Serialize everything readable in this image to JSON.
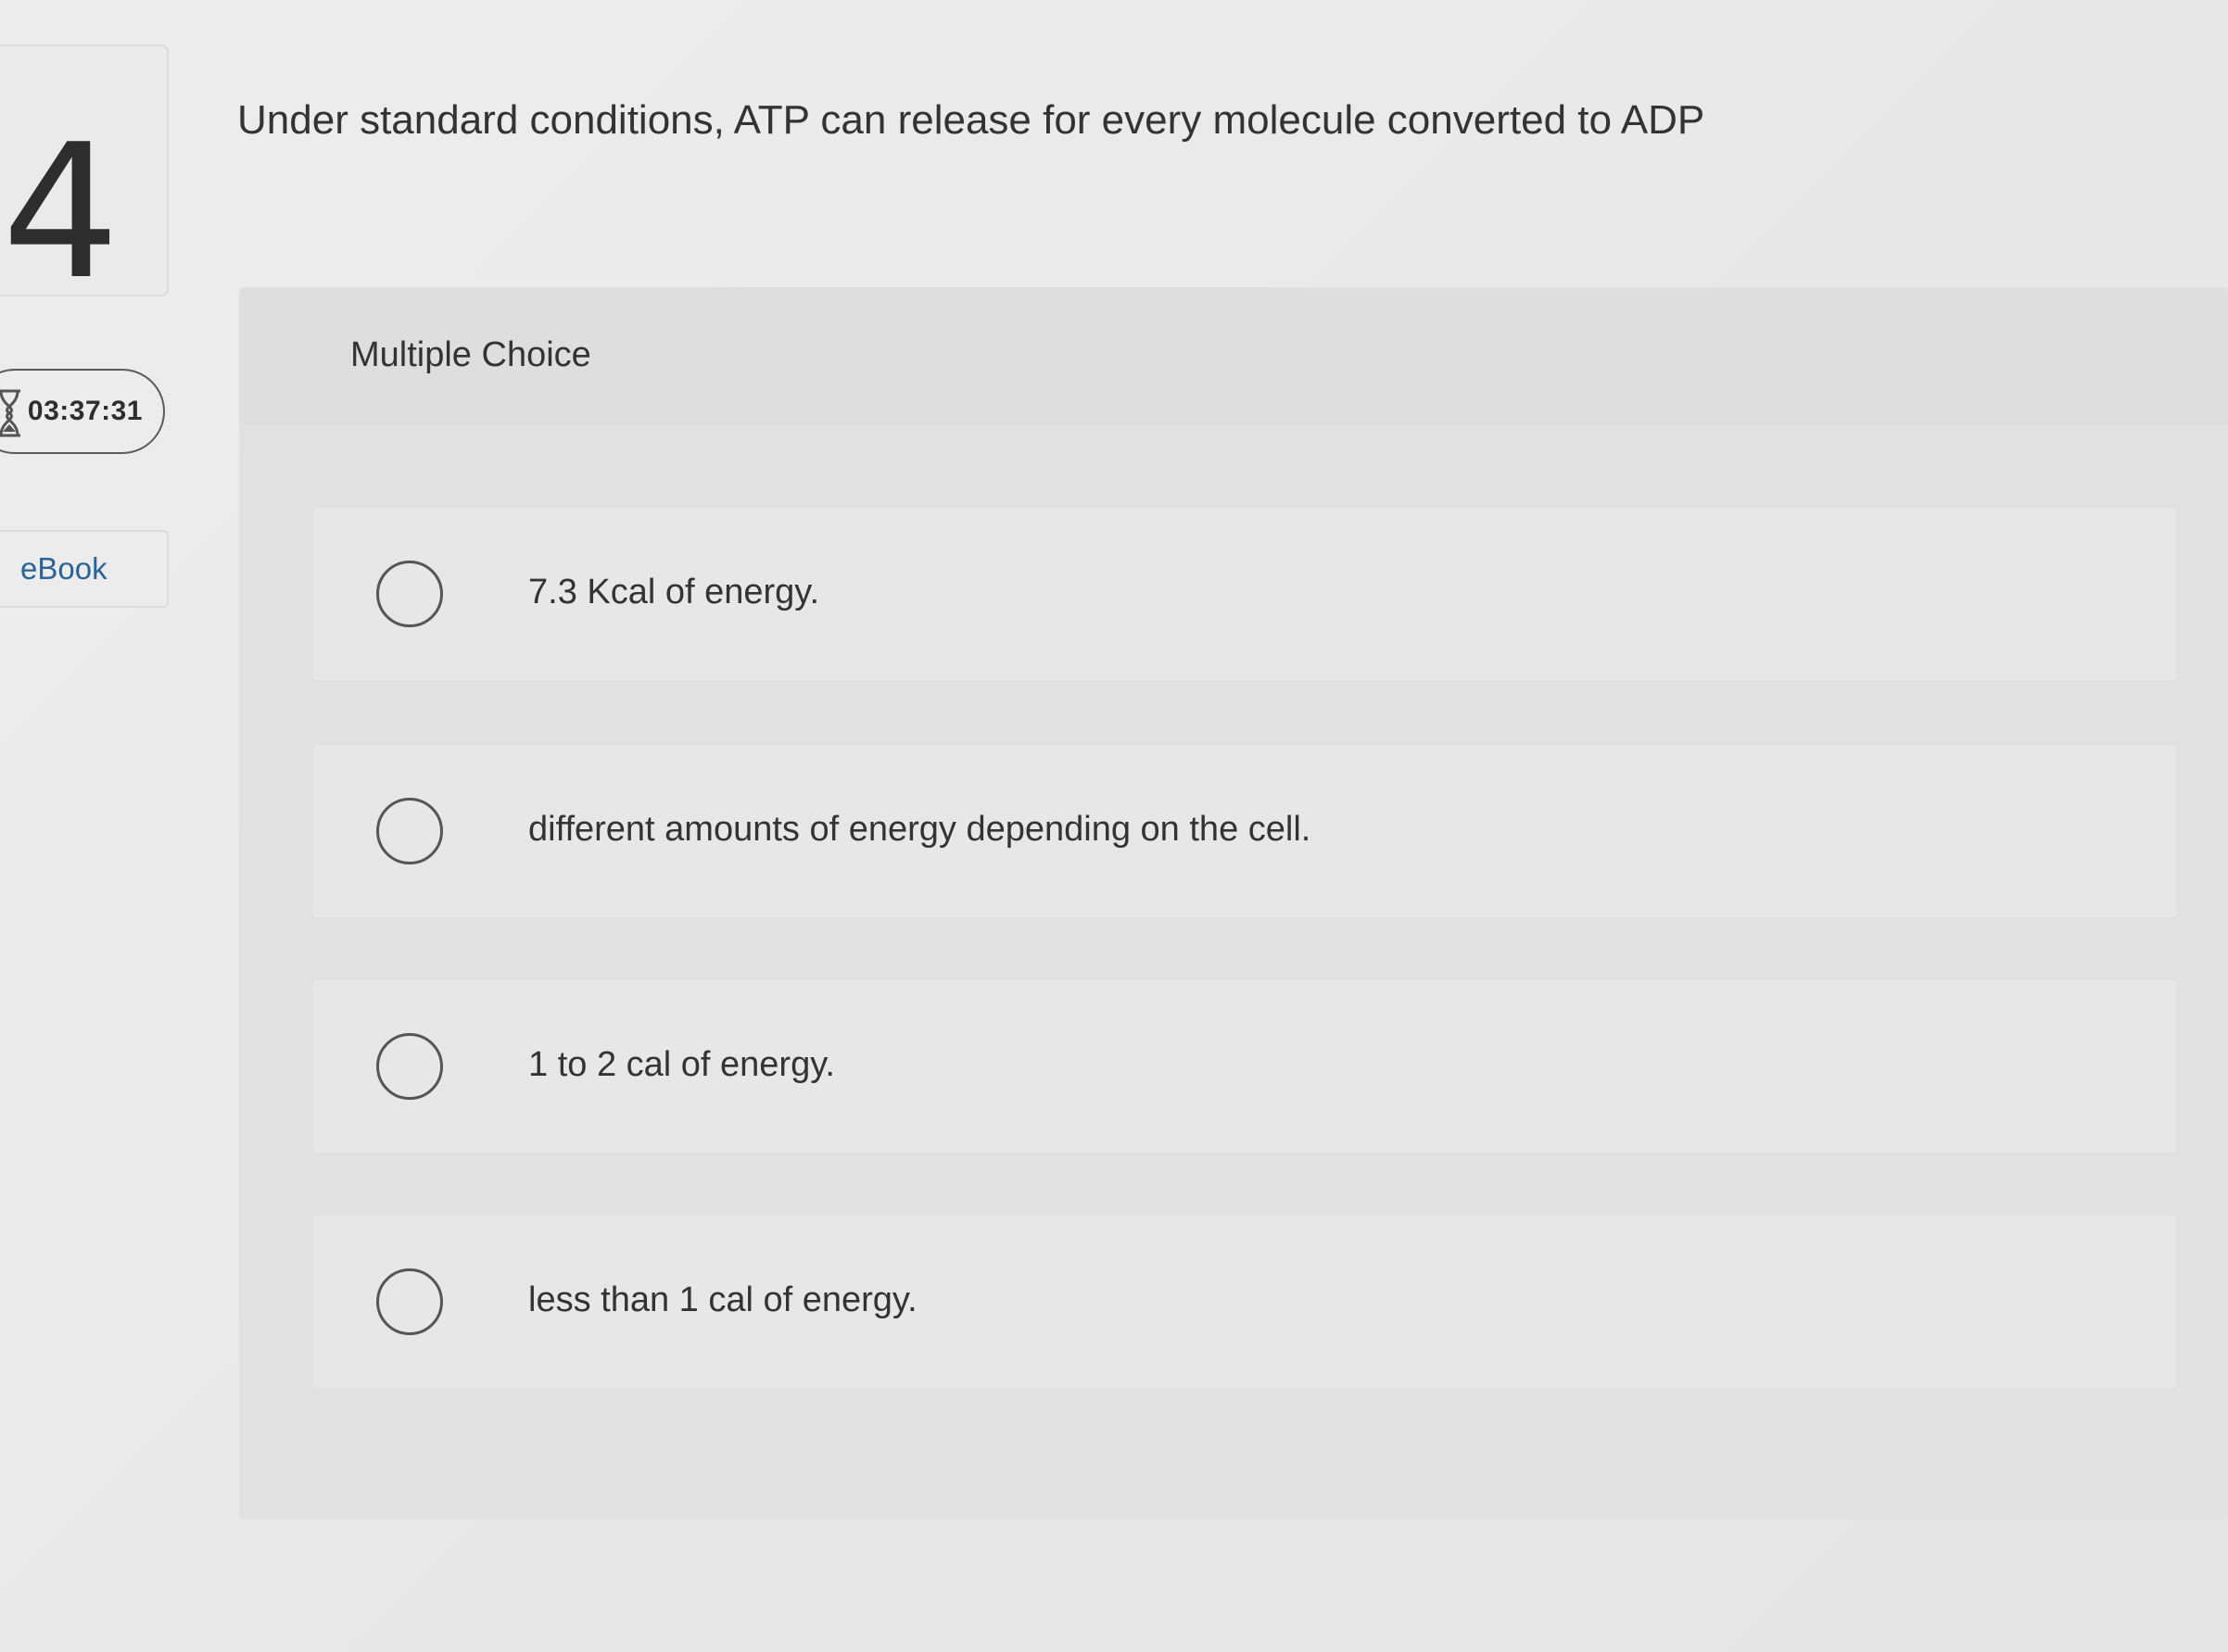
{
  "sidebar": {
    "question_number": "4",
    "timer": "03:37:31",
    "ebook_label": "eBook"
  },
  "question": {
    "text": "Under standard conditions, ATP can release for every molecule converted to ADP",
    "type_label": "Multiple Choice",
    "options": [
      {
        "label": "7.3 Kcal of energy.",
        "selected": false
      },
      {
        "label": "different amounts of energy depending on the cell.",
        "selected": false
      },
      {
        "label": "1 to 2 cal of energy.",
        "selected": false
      },
      {
        "label": "less than 1 cal of energy.",
        "selected": false
      }
    ]
  },
  "colors": {
    "background": "#e9e9e9",
    "panel": "#e1e1e1",
    "option_bg": "#e7e7e7",
    "link": "#2a6496",
    "text": "#333333"
  }
}
